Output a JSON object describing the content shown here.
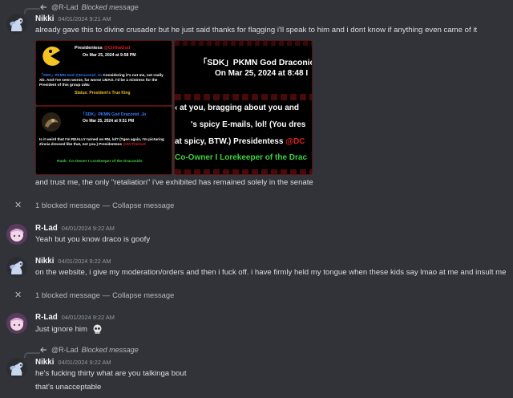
{
  "messages": {
    "m1": {
      "reply": {
        "user": "@R-Lad",
        "status": "Blocked message"
      },
      "user": "Nikki",
      "time": "04/01/2024 9:21 AM",
      "text": "already gave this to divine crusader but he just said thanks for flagging i'll speak to him and i dont know if anything even came of it",
      "text2": "and trust me, the only \"retaliation\" i've exhibited has remained solely in the senate"
    },
    "b1": {
      "label": "1 blocked message",
      "dash": "—",
      "action": "Collapse message"
    },
    "m2": {
      "user": "R-Lad",
      "time": "04/01/2024 9:22 AM",
      "text": "Yeah but you know draco is goofy"
    },
    "m3": {
      "user": "Nikki",
      "time": "04/01/2024 9:22 AM",
      "text": "on the website, i give my moderation/orders and then i fuck off. i have firmly held my tongue when these kids say lmao at me and insult me"
    },
    "b2": {
      "label": "1 blocked message",
      "dash": "—",
      "action": "Collapse message"
    },
    "m4": {
      "user": "R-Lad",
      "time": "04/01/2024 9:22 AM",
      "text": "Just ignore him"
    },
    "m5": {
      "reply": {
        "user": "@R-Lad",
        "status": "Blocked message"
      },
      "user": "Nikki",
      "time": "04/01/2024 9:22 AM",
      "text": "he's fucking thirty what are you talkinga bout",
      "text2": "that's unacceptable"
    }
  },
  "images": {
    "img1": {
      "title": "Presidentess",
      "title_mention": "@CirthaGod",
      "date": "On Mar 25, 2024 at 9:58 PM",
      "body_prefix": "「SDK」PKMN God @Draconid_Jo",
      "body": "Considering it's not me, not really XD. And I've seen worse, far worse LMAO. I'd be a mistress for the President of this group uWu",
      "status": "Status: President's True King"
    },
    "img2": {
      "title": "「SDK」PKMN God Draconid_Jo",
      "date": "On Mar 25, 2024 at 9:51 PM",
      "body": "Is it weird that I'm REALLY turned on RN, lol?",
      "body2": "(Tgen again, I'm picturing Zinnia dressed like that, not you.) Presidentess",
      "mention": "@DCTheGod",
      "rank": "Rank: Co-Owner I Lorekeeper of the Draconids"
    },
    "img3": {
      "title": "「SDK」PKMN God Draconic",
      "date": "On Mar 25, 2024 at 8:48 I",
      "line1": "‹ at you, bragging about you and",
      "line2": "'s spicy E-mails, lol! (You dres",
      "line3": "at spicy, BTW.) Presidentess",
      "mention": "@DC",
      "rank": "Co-Owner I Lorekeeper of the Drac"
    }
  },
  "colors": {
    "bg": "#313338",
    "name": "#f2f3f5",
    "red": "#e02020",
    "green": "#3fd13f",
    "gold": "#e8c020",
    "blue": "#3a7bff"
  }
}
